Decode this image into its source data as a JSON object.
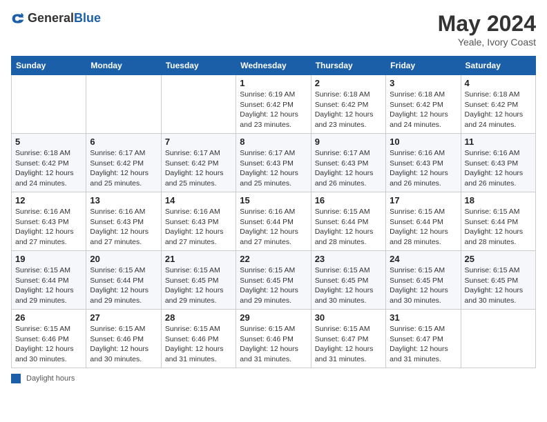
{
  "header": {
    "logo_general": "General",
    "logo_blue": "Blue",
    "month_year": "May 2024",
    "location": "Yeale, Ivory Coast"
  },
  "weekdays": [
    "Sunday",
    "Monday",
    "Tuesday",
    "Wednesday",
    "Thursday",
    "Friday",
    "Saturday"
  ],
  "footer": {
    "label": "Daylight hours"
  },
  "weeks": [
    [
      {
        "day": "",
        "sunrise": "",
        "sunset": "",
        "daylight": ""
      },
      {
        "day": "",
        "sunrise": "",
        "sunset": "",
        "daylight": ""
      },
      {
        "day": "",
        "sunrise": "",
        "sunset": "",
        "daylight": ""
      },
      {
        "day": "1",
        "sunrise": "Sunrise: 6:19 AM",
        "sunset": "Sunset: 6:42 PM",
        "daylight": "Daylight: 12 hours and 23 minutes."
      },
      {
        "day": "2",
        "sunrise": "Sunrise: 6:18 AM",
        "sunset": "Sunset: 6:42 PM",
        "daylight": "Daylight: 12 hours and 23 minutes."
      },
      {
        "day": "3",
        "sunrise": "Sunrise: 6:18 AM",
        "sunset": "Sunset: 6:42 PM",
        "daylight": "Daylight: 12 hours and 24 minutes."
      },
      {
        "day": "4",
        "sunrise": "Sunrise: 6:18 AM",
        "sunset": "Sunset: 6:42 PM",
        "daylight": "Daylight: 12 hours and 24 minutes."
      }
    ],
    [
      {
        "day": "5",
        "sunrise": "Sunrise: 6:18 AM",
        "sunset": "Sunset: 6:42 PM",
        "daylight": "Daylight: 12 hours and 24 minutes."
      },
      {
        "day": "6",
        "sunrise": "Sunrise: 6:17 AM",
        "sunset": "Sunset: 6:42 PM",
        "daylight": "Daylight: 12 hours and 25 minutes."
      },
      {
        "day": "7",
        "sunrise": "Sunrise: 6:17 AM",
        "sunset": "Sunset: 6:42 PM",
        "daylight": "Daylight: 12 hours and 25 minutes."
      },
      {
        "day": "8",
        "sunrise": "Sunrise: 6:17 AM",
        "sunset": "Sunset: 6:43 PM",
        "daylight": "Daylight: 12 hours and 25 minutes."
      },
      {
        "day": "9",
        "sunrise": "Sunrise: 6:17 AM",
        "sunset": "Sunset: 6:43 PM",
        "daylight": "Daylight: 12 hours and 26 minutes."
      },
      {
        "day": "10",
        "sunrise": "Sunrise: 6:16 AM",
        "sunset": "Sunset: 6:43 PM",
        "daylight": "Daylight: 12 hours and 26 minutes."
      },
      {
        "day": "11",
        "sunrise": "Sunrise: 6:16 AM",
        "sunset": "Sunset: 6:43 PM",
        "daylight": "Daylight: 12 hours and 26 minutes."
      }
    ],
    [
      {
        "day": "12",
        "sunrise": "Sunrise: 6:16 AM",
        "sunset": "Sunset: 6:43 PM",
        "daylight": "Daylight: 12 hours and 27 minutes."
      },
      {
        "day": "13",
        "sunrise": "Sunrise: 6:16 AM",
        "sunset": "Sunset: 6:43 PM",
        "daylight": "Daylight: 12 hours and 27 minutes."
      },
      {
        "day": "14",
        "sunrise": "Sunrise: 6:16 AM",
        "sunset": "Sunset: 6:43 PM",
        "daylight": "Daylight: 12 hours and 27 minutes."
      },
      {
        "day": "15",
        "sunrise": "Sunrise: 6:16 AM",
        "sunset": "Sunset: 6:44 PM",
        "daylight": "Daylight: 12 hours and 27 minutes."
      },
      {
        "day": "16",
        "sunrise": "Sunrise: 6:15 AM",
        "sunset": "Sunset: 6:44 PM",
        "daylight": "Daylight: 12 hours and 28 minutes."
      },
      {
        "day": "17",
        "sunrise": "Sunrise: 6:15 AM",
        "sunset": "Sunset: 6:44 PM",
        "daylight": "Daylight: 12 hours and 28 minutes."
      },
      {
        "day": "18",
        "sunrise": "Sunrise: 6:15 AM",
        "sunset": "Sunset: 6:44 PM",
        "daylight": "Daylight: 12 hours and 28 minutes."
      }
    ],
    [
      {
        "day": "19",
        "sunrise": "Sunrise: 6:15 AM",
        "sunset": "Sunset: 6:44 PM",
        "daylight": "Daylight: 12 hours and 29 minutes."
      },
      {
        "day": "20",
        "sunrise": "Sunrise: 6:15 AM",
        "sunset": "Sunset: 6:44 PM",
        "daylight": "Daylight: 12 hours and 29 minutes."
      },
      {
        "day": "21",
        "sunrise": "Sunrise: 6:15 AM",
        "sunset": "Sunset: 6:45 PM",
        "daylight": "Daylight: 12 hours and 29 minutes."
      },
      {
        "day": "22",
        "sunrise": "Sunrise: 6:15 AM",
        "sunset": "Sunset: 6:45 PM",
        "daylight": "Daylight: 12 hours and 29 minutes."
      },
      {
        "day": "23",
        "sunrise": "Sunrise: 6:15 AM",
        "sunset": "Sunset: 6:45 PM",
        "daylight": "Daylight: 12 hours and 30 minutes."
      },
      {
        "day": "24",
        "sunrise": "Sunrise: 6:15 AM",
        "sunset": "Sunset: 6:45 PM",
        "daylight": "Daylight: 12 hours and 30 minutes."
      },
      {
        "day": "25",
        "sunrise": "Sunrise: 6:15 AM",
        "sunset": "Sunset: 6:45 PM",
        "daylight": "Daylight: 12 hours and 30 minutes."
      }
    ],
    [
      {
        "day": "26",
        "sunrise": "Sunrise: 6:15 AM",
        "sunset": "Sunset: 6:46 PM",
        "daylight": "Daylight: 12 hours and 30 minutes."
      },
      {
        "day": "27",
        "sunrise": "Sunrise: 6:15 AM",
        "sunset": "Sunset: 6:46 PM",
        "daylight": "Daylight: 12 hours and 30 minutes."
      },
      {
        "day": "28",
        "sunrise": "Sunrise: 6:15 AM",
        "sunset": "Sunset: 6:46 PM",
        "daylight": "Daylight: 12 hours and 31 minutes."
      },
      {
        "day": "29",
        "sunrise": "Sunrise: 6:15 AM",
        "sunset": "Sunset: 6:46 PM",
        "daylight": "Daylight: 12 hours and 31 minutes."
      },
      {
        "day": "30",
        "sunrise": "Sunrise: 6:15 AM",
        "sunset": "Sunset: 6:47 PM",
        "daylight": "Daylight: 12 hours and 31 minutes."
      },
      {
        "day": "31",
        "sunrise": "Sunrise: 6:15 AM",
        "sunset": "Sunset: 6:47 PM",
        "daylight": "Daylight: 12 hours and 31 minutes."
      },
      {
        "day": "",
        "sunrise": "",
        "sunset": "",
        "daylight": ""
      }
    ]
  ]
}
